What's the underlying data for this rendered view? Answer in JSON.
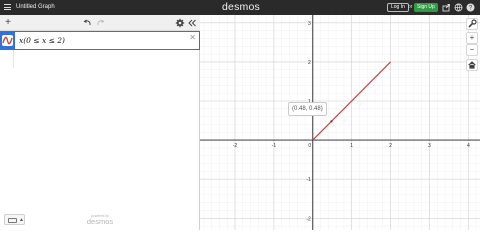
{
  "topbar": {
    "title": "Untitled Graph",
    "logo": "desmos",
    "login_label": "Log In",
    "or_label": "or",
    "signup_label": "Sign Up",
    "icons": [
      "share-icon",
      "globe-icon",
      "help-icon",
      "settings-icon"
    ]
  },
  "panel": {
    "toolbar": {
      "add_icon": "plus-icon",
      "undo_icon": "undo-icon",
      "redo_icon": "redo-icon",
      "settings_icon": "gear-icon",
      "collapse_icon": "double-chevron-left-icon"
    },
    "expressions": [
      {
        "latex": "x(0 ≤ x ≤ 2)",
        "color": "#c74440"
      }
    ],
    "powered_by_small": "powered by",
    "powered_by_logo": "desmos"
  },
  "graph": {
    "side_buttons": [
      "wrench-icon",
      "zoom-in-icon",
      "zoom-out-icon",
      "home-icon"
    ],
    "tooltip": "(0.48, 0.48)",
    "x_tick_labels": [
      "-2",
      "-1",
      "0",
      "1",
      "2",
      "3",
      "4"
    ],
    "y_tick_labels": [
      "3",
      "2",
      "1",
      "-1",
      "-2"
    ],
    "x_range": [
      -2.9,
      4.3
    ],
    "y_range": [
      -2.3,
      3.2
    ],
    "curve_color": "#c74440",
    "curve_domain": [
      0,
      2
    ],
    "point": [
      0.48,
      0.48
    ]
  }
}
